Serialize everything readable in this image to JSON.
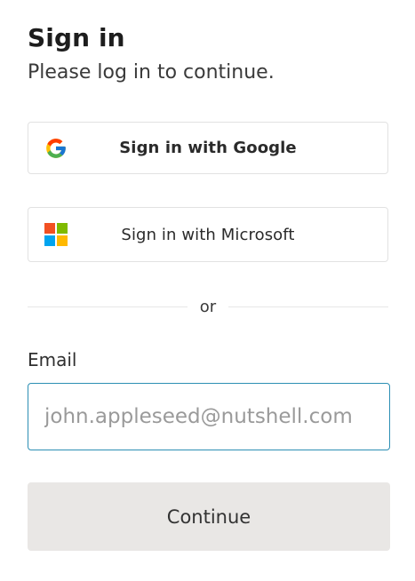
{
  "header": {
    "title": "Sign in",
    "subtitle": "Please log in to continue."
  },
  "sso": {
    "google_label": "Sign in with Google",
    "microsoft_label": "Sign in with Microsoft"
  },
  "divider": {
    "text": "or"
  },
  "email": {
    "label": "Email",
    "value": "",
    "placeholder": "john.appleseed@nutshell.com"
  },
  "actions": {
    "continue_label": "Continue"
  },
  "colors": {
    "input_focus_border": "#2c8fb4",
    "continue_bg": "#e9e7e5",
    "google_blue": "#4285F4",
    "google_red": "#EA4335",
    "google_yellow": "#FBBC05",
    "google_green": "#34A853",
    "ms_red": "#F25022",
    "ms_green": "#7FBA00",
    "ms_blue": "#00A4EF",
    "ms_yellow": "#FFB900"
  }
}
